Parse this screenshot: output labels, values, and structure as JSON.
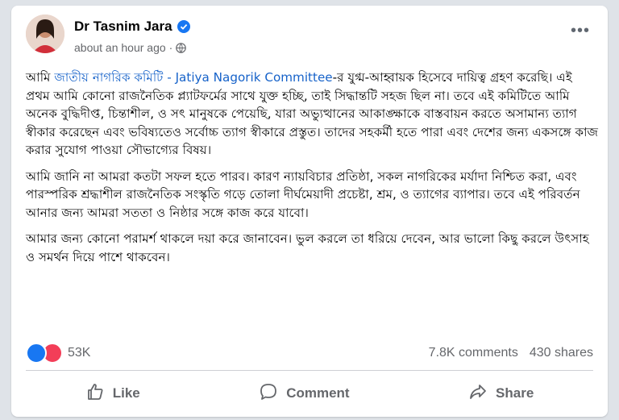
{
  "post": {
    "author": "Dr Tasnim Jara",
    "time": "about an hour ago",
    "more_label": "•••",
    "paragraphs": {
      "p1_a": "আমি ",
      "p1_link_bn": "জাতীয় নাগরিক কমিটি",
      "p1_sep": " - ",
      "p1_link_en": "Jatiya Nagorik Committee",
      "p1_b": "-র যুগ্ম-আহ্বায়ক হিসেবে দায়িত্ব গ্রহণ করেছি। এই প্রথম আমি কোনো রাজনৈতিক প্ল্যাটফর্মের সাথে যুক্ত হচ্ছি, তাই সিদ্ধান্তটি সহজ ছিল না। তবে এই কমিটিতে আমি অনেক বুদ্ধিদীপ্ত, চিন্তাশীল, ও সৎ মানুষকে পেয়েছি, যারা অভ্যুত্থানের আকাঙ্ক্ষাকে বাস্তবায়ন করতে অসামান্য ত্যাগ স্বীকার করেছেন এবং ভবিষ্যতেও সর্বোচ্চ ত্যাগ স্বীকারে প্রস্তুত। তাদের সহকর্মী হতে পারা এবং দেশের জন্য একসঙ্গে কাজ করার সুযোগ পাওয়া সৌভাগ্যের বিষয়।",
      "p2": "আমি জানি না আমরা কতটা সফল হতে পারব। কারণ ন্যায়বিচার প্রতিষ্ঠা, সকল নাগরিকের মর্যাদা নিশ্চিত করা, এবং পারস্পরিক শ্রদ্ধাশীল রাজনৈতিক সংস্কৃতি গড়ে তোলা দীর্ঘমেয়াদী প্রচেষ্টা, শ্রম, ও ত্যাগের ব্যাপার। তবে এই পরিবর্তন আনার জন্য আমরা সততা ও নিষ্ঠার সঙ্গে কাজ করে যাবো।",
      "p3": "আমার জন্য কোনো পরামর্শ থাকলে দয়া করে জানাবেন। ভুল করলে তা ধরিয়ে দেবেন, আর ভালো কিছু করলে উৎসাহ ও সমর্থন দিয়ে পাশে থাকবেন।"
    }
  },
  "stats": {
    "reactions": "53K",
    "comments": "7.8K comments",
    "shares": "430 shares"
  },
  "actions": {
    "like": "Like",
    "comment": "Comment",
    "share": "Share"
  },
  "colors": {
    "link": "#1662c9",
    "verified": "#1877f2",
    "like_reaction": "#1877f2",
    "love_reaction": "#f33e58"
  },
  "icons": [
    "verified-badge-icon",
    "globe-icon",
    "like-reaction-icon",
    "love-reaction-icon",
    "thumbs-up-icon",
    "comment-icon",
    "share-icon"
  ]
}
